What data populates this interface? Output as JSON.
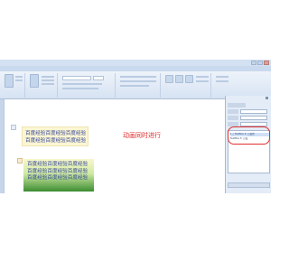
{
  "window": {
    "title": ""
  },
  "ribbon": {
    "tabs": [
      "",
      "",
      "",
      "",
      "",
      "",
      ""
    ]
  },
  "slide": {
    "textbox1_lines": [
      "百度经验百度经验百度经验",
      "百度经验百度经验百度经验"
    ],
    "textbox2_lines": [
      "百度经验百度经验百度经验",
      "百度经验百度经验百度经验",
      "百度经验百度经验百度经验"
    ],
    "annotation": "动画同时进行"
  },
  "pane": {
    "title": "",
    "animations": [
      "1 🖱 TextBox 4: 百度经",
      "TextBox 5: 百度"
    ]
  },
  "colors": {
    "annotation": "#e02a2a",
    "highlight": "#e03030"
  }
}
